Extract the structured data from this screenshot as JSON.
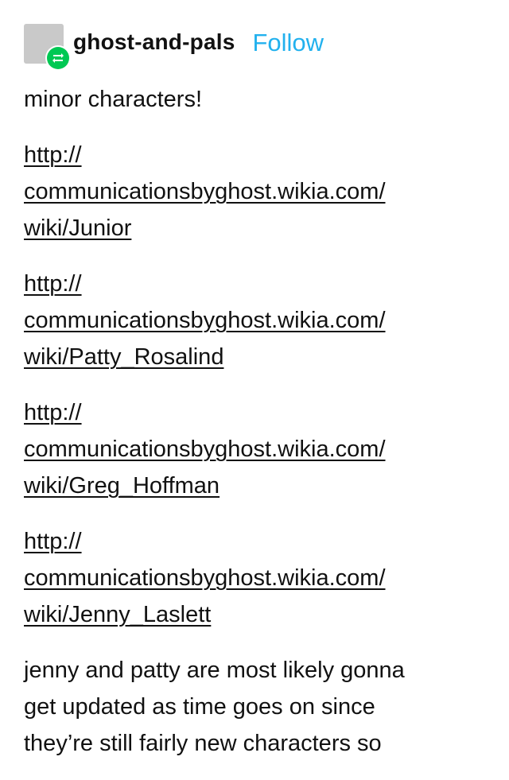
{
  "header": {
    "username": "ghost-and-pals",
    "follow_label": "Follow",
    "avatar_icon": "avatar-placeholder",
    "badge_icon": "reblog-icon",
    "badge_color": "#00c853",
    "follow_color": "#22b1ee"
  },
  "post": {
    "intro": "minor characters!",
    "links": [
      {
        "line1": "http://",
        "line2": "communicationsbyghost.wikia.com/",
        "line3": "wiki/Junior"
      },
      {
        "line1": "http://",
        "line2": "communicationsbyghost.wikia.com/",
        "line3": "wiki/Patty_Rosalind"
      },
      {
        "line1": "http://",
        "line2": "communicationsbyghost.wikia.com/",
        "line3": "wiki/Greg_Hoffman"
      },
      {
        "line1": "http://",
        "line2": "communicationsbyghost.wikia.com/",
        "line3": "wiki/Jenny_Laslett"
      }
    ],
    "outro_line1": "jenny and patty are most likely gonna",
    "outro_line2": "get updated as time goes on since",
    "outro_line3": "they’re still fairly new characters so"
  }
}
